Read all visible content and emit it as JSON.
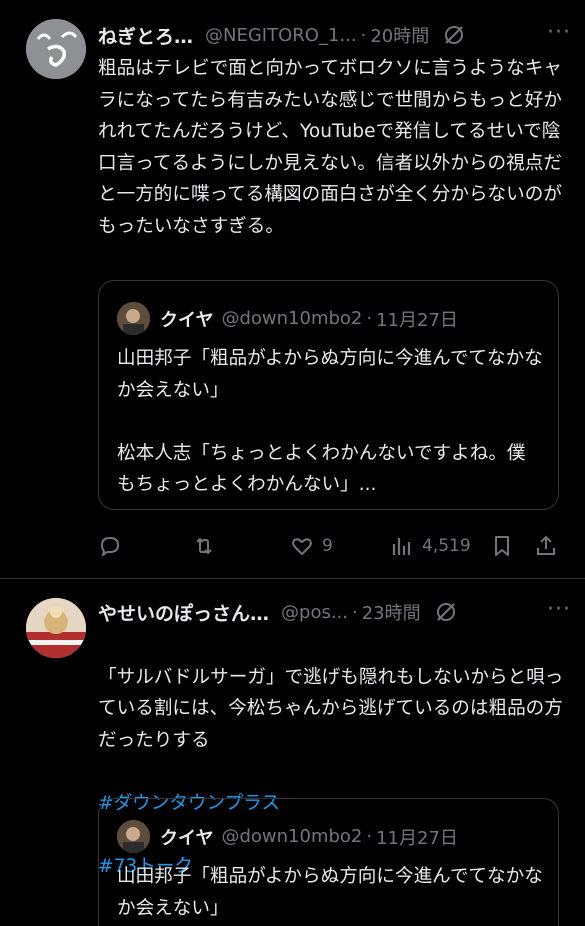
{
  "tweets": [
    {
      "author_name": "ねぎとろ…",
      "handle": "@NEGITORO_1...",
      "separator": "·",
      "time": "20時間",
      "more": "···",
      "text": "粗品はテレビで面と向かってボロクソに言うようなキャラになってたら有吉みたいな感じで世間からもっと好かれれてたんだろうけど、YouTubeで発信してるせいで陰口言ってるようにしか見えない。信者以外からの視点だと一方的に喋ってる構図の面白さが全く分からないのがもったいなさすぎる。",
      "quote": {
        "author_name": "クイヤ",
        "handle": "@down10mbo2",
        "separator": "·",
        "date": "11月27日",
        "text": "山田邦子「粗品がよからぬ方向に今進んでてなかなか会えない」\n\n松本人志「ちょっとよくわかんないですよね。僕もちょっとよくわかんない」..."
      },
      "actions": {
        "reply_count": "",
        "retweet_count": "",
        "like_count": "9",
        "views_count": "4,519"
      }
    },
    {
      "author_name": "やせいのぽっさん…",
      "handle": "@pos...",
      "separator": "·",
      "time": "23時間",
      "more": "···",
      "text": "「サルバドルサーガ」で逃げも隠れもしないからと唄っている割には、今松ちゃんから逃げているのは粗品の方だったりする",
      "hashtags": [
        "#ダウンタウンプラス",
        "#73トーク"
      ],
      "quote": {
        "author_name": "クイヤ",
        "handle": "@down10mbo2",
        "separator": "·",
        "date": "11月27日",
        "text": "山田邦子「粗品がよからぬ方向に今進んでてなかなか会えない」"
      }
    }
  ],
  "icons": {
    "grok": "grok-icon",
    "reply": "reply-icon",
    "retweet": "retweet-icon",
    "like": "heart-icon",
    "views": "views-icon",
    "bookmark": "bookmark-icon",
    "share": "share-icon"
  },
  "colors": {
    "background": "#000000",
    "text": "#e7e9ea",
    "secondary": "#71767b",
    "link": "#1d9bf0",
    "border": "#2f3336"
  }
}
